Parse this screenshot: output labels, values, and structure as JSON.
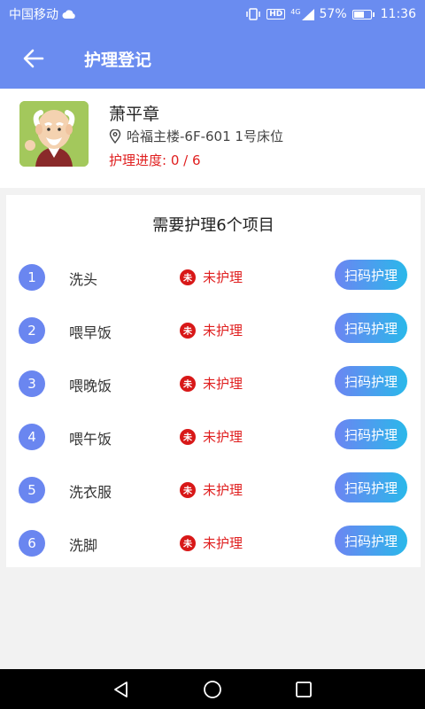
{
  "status_bar": {
    "carrier": "中国移动",
    "hd": "HD",
    "network": "4G",
    "battery": "57%",
    "time": "11:36"
  },
  "app_bar": {
    "title": "护理登记",
    "back_icon": "arrow-left-icon"
  },
  "patient": {
    "name": "萧平章",
    "location": "哈福主楼-6F-601 1号床位",
    "progress_label": "护理进度: 0 / 6"
  },
  "tasks": {
    "heading": "需要护理6个项目",
    "status_icon_text": "未",
    "items": [
      {
        "index": "1",
        "label": "洗头",
        "status": "未护理",
        "action": "扫码护理"
      },
      {
        "index": "2",
        "label": "喂早饭",
        "status": "未护理",
        "action": "扫码护理"
      },
      {
        "index": "3",
        "label": "喂晚饭",
        "status": "未护理",
        "action": "扫码护理"
      },
      {
        "index": "4",
        "label": "喂午饭",
        "status": "未护理",
        "action": "扫码护理"
      },
      {
        "index": "5",
        "label": "洗衣服",
        "status": "未护理",
        "action": "扫码护理"
      },
      {
        "index": "6",
        "label": "洗脚",
        "status": "未护理",
        "action": "扫码护理"
      }
    ]
  },
  "colors": {
    "primary": "#6a8cf0",
    "alert": "#e02020",
    "button_gradient_start": "#6c85f2",
    "button_gradient_end": "#2ab8ea"
  }
}
